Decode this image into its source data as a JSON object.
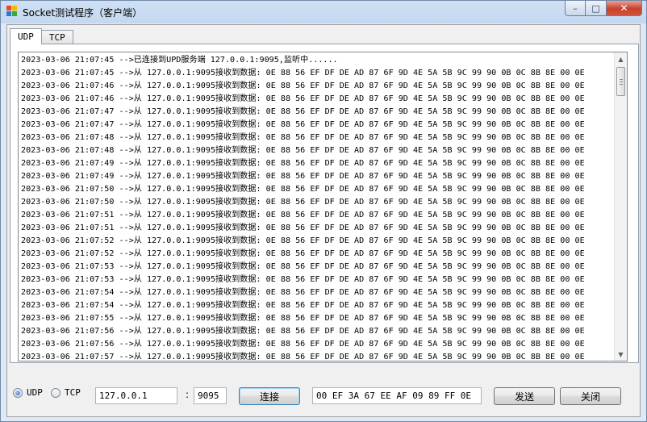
{
  "window": {
    "title": "Socket测试程序（客户端）",
    "controls": {
      "minimize": "–",
      "maximize": "□",
      "close": "✕"
    }
  },
  "tabs": [
    {
      "label": "UDP",
      "active": true
    },
    {
      "label": "TCP",
      "active": false
    }
  ],
  "log": {
    "lines": [
      "2023-03-06 21:07:45 -->已连接到UPD服务端 127.0.0.1:9095,监听中......",
      "2023-03-06 21:07:45 -->从 127.0.0.1:9095接收到数据: 0E 88 56 EF DF DE AD 87 6F 9D 4E 5A 5B 9C 99 90 0B 0C 8B 8E 00 0E",
      "2023-03-06 21:07:46 -->从 127.0.0.1:9095接收到数据: 0E 88 56 EF DF DE AD 87 6F 9D 4E 5A 5B 9C 99 90 0B 0C 8B 8E 00 0E",
      "2023-03-06 21:07:46 -->从 127.0.0.1:9095接收到数据: 0E 88 56 EF DF DE AD 87 6F 9D 4E 5A 5B 9C 99 90 0B 0C 8B 8E 00 0E",
      "2023-03-06 21:07:47 -->从 127.0.0.1:9095接收到数据: 0E 88 56 EF DF DE AD 87 6F 9D 4E 5A 5B 9C 99 90 0B 0C 8B 8E 00 0E",
      "2023-03-06 21:07:47 -->从 127.0.0.1:9095接收到数据: 0E 88 56 EF DF DE AD 87 6F 9D 4E 5A 5B 9C 99 90 0B 0C 8B 8E 00 0E",
      "2023-03-06 21:07:48 -->从 127.0.0.1:9095接收到数据: 0E 88 56 EF DF DE AD 87 6F 9D 4E 5A 5B 9C 99 90 0B 0C 8B 8E 00 0E",
      "2023-03-06 21:07:48 -->从 127.0.0.1:9095接收到数据: 0E 88 56 EF DF DE AD 87 6F 9D 4E 5A 5B 9C 99 90 0B 0C 8B 8E 00 0E",
      "2023-03-06 21:07:49 -->从 127.0.0.1:9095接收到数据: 0E 88 56 EF DF DE AD 87 6F 9D 4E 5A 5B 9C 99 90 0B 0C 8B 8E 00 0E",
      "2023-03-06 21:07:49 -->从 127.0.0.1:9095接收到数据: 0E 88 56 EF DF DE AD 87 6F 9D 4E 5A 5B 9C 99 90 0B 0C 8B 8E 00 0E",
      "2023-03-06 21:07:50 -->从 127.0.0.1:9095接收到数据: 0E 88 56 EF DF DE AD 87 6F 9D 4E 5A 5B 9C 99 90 0B 0C 8B 8E 00 0E",
      "2023-03-06 21:07:50 -->从 127.0.0.1:9095接收到数据: 0E 88 56 EF DF DE AD 87 6F 9D 4E 5A 5B 9C 99 90 0B 0C 8B 8E 00 0E",
      "2023-03-06 21:07:51 -->从 127.0.0.1:9095接收到数据: 0E 88 56 EF DF DE AD 87 6F 9D 4E 5A 5B 9C 99 90 0B 0C 8B 8E 00 0E",
      "2023-03-06 21:07:51 -->从 127.0.0.1:9095接收到数据: 0E 88 56 EF DF DE AD 87 6F 9D 4E 5A 5B 9C 99 90 0B 0C 8B 8E 00 0E",
      "2023-03-06 21:07:52 -->从 127.0.0.1:9095接收到数据: 0E 88 56 EF DF DE AD 87 6F 9D 4E 5A 5B 9C 99 90 0B 0C 8B 8E 00 0E",
      "2023-03-06 21:07:52 -->从 127.0.0.1:9095接收到数据: 0E 88 56 EF DF DE AD 87 6F 9D 4E 5A 5B 9C 99 90 0B 0C 8B 8E 00 0E",
      "2023-03-06 21:07:53 -->从 127.0.0.1:9095接收到数据: 0E 88 56 EF DF DE AD 87 6F 9D 4E 5A 5B 9C 99 90 0B 0C 8B 8E 00 0E",
      "2023-03-06 21:07:53 -->从 127.0.0.1:9095接收到数据: 0E 88 56 EF DF DE AD 87 6F 9D 4E 5A 5B 9C 99 90 0B 0C 8B 8E 00 0E",
      "2023-03-06 21:07:54 -->从 127.0.0.1:9095接收到数据: 0E 88 56 EF DF DE AD 87 6F 9D 4E 5A 5B 9C 99 90 0B 0C 8B 8E 00 0E",
      "2023-03-06 21:07:54 -->从 127.0.0.1:9095接收到数据: 0E 88 56 EF DF DE AD 87 6F 9D 4E 5A 5B 9C 99 90 0B 0C 8B 8E 00 0E",
      "2023-03-06 21:07:55 -->从 127.0.0.1:9095接收到数据: 0E 88 56 EF DF DE AD 87 6F 9D 4E 5A 5B 9C 99 90 0B 0C 8B 8E 00 0E",
      "2023-03-06 21:07:56 -->从 127.0.0.1:9095接收到数据: 0E 88 56 EF DF DE AD 87 6F 9D 4E 5A 5B 9C 99 90 0B 0C 8B 8E 00 0E",
      "2023-03-06 21:07:56 -->从 127.0.0.1:9095接收到数据: 0E 88 56 EF DF DE AD 87 6F 9D 4E 5A 5B 9C 99 90 0B 0C 8B 8E 00 0E",
      "2023-03-06 21:07:57 -->从 127.0.0.1:9095接收到数据: 0E 88 56 EF DF DE AD 87 6F 9D 4E 5A 5B 9C 99 90 0B 0C 8B 8E 00 0E"
    ]
  },
  "protocol": {
    "options": [
      {
        "label": "UDP",
        "checked": true
      },
      {
        "label": "TCP",
        "checked": false
      }
    ]
  },
  "connection": {
    "ip": "127.0.0.1",
    "separator": ":",
    "port": "9095",
    "connect_label": "连接"
  },
  "send": {
    "data": "00 EF 3A 67 EE AF 09 89 FF 0E",
    "send_label": "发送",
    "close_label": "关闭"
  },
  "icons": {
    "app": "app-icon",
    "scroll_up": "▲",
    "scroll_down": "▼"
  }
}
